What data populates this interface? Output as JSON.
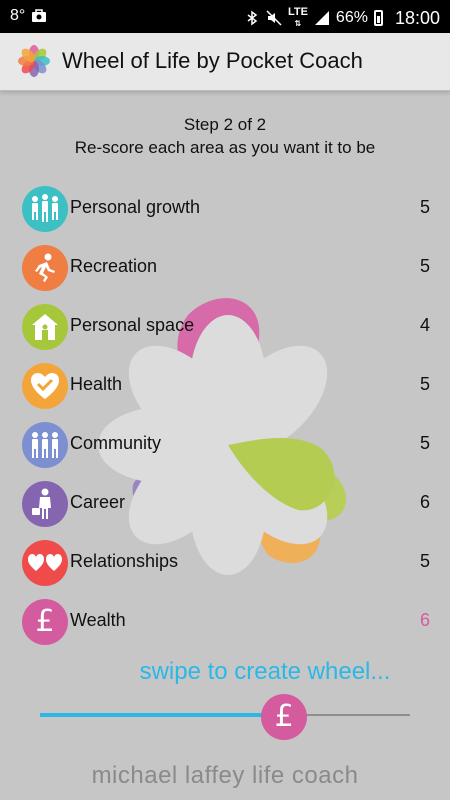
{
  "status_bar": {
    "notification_count": "8°",
    "lte": "LTE",
    "battery": "66%",
    "time": "18:00"
  },
  "app": {
    "title": "Wheel of Life by Pocket Coach"
  },
  "header": {
    "step": "Step 2 of 2",
    "instruction": "Re-score each area as you want it to be"
  },
  "areas": [
    {
      "label": "Personal growth",
      "score": "5",
      "color": "#3cc0c3",
      "icon": "people-icon"
    },
    {
      "label": "Recreation",
      "score": "5",
      "color": "#f07d42",
      "icon": "runner-icon"
    },
    {
      "label": "Personal space",
      "score": "4",
      "color": "#a6c73a",
      "icon": "house-icon"
    },
    {
      "label": "Health",
      "score": "5",
      "color": "#f4a53a",
      "icon": "heart-check-icon"
    },
    {
      "label": "Community",
      "score": "5",
      "color": "#7c8fd0",
      "icon": "group-icon"
    },
    {
      "label": "Career",
      "score": "6",
      "color": "#8665b0",
      "icon": "briefcase-person-icon"
    },
    {
      "label": "Relationships",
      "score": "5",
      "color": "#ef4b4b",
      "icon": "hearts-icon"
    },
    {
      "label": "Wealth",
      "score": "6",
      "color": "#d45b9e",
      "icon": "pound-icon",
      "score_color": "#d45b9e"
    }
  ],
  "swipe_hint": "swipe to create wheel...",
  "slider": {
    "value_fraction": 0.66,
    "accent": "#2bb8e6"
  },
  "footer": "michael laffey life coach"
}
